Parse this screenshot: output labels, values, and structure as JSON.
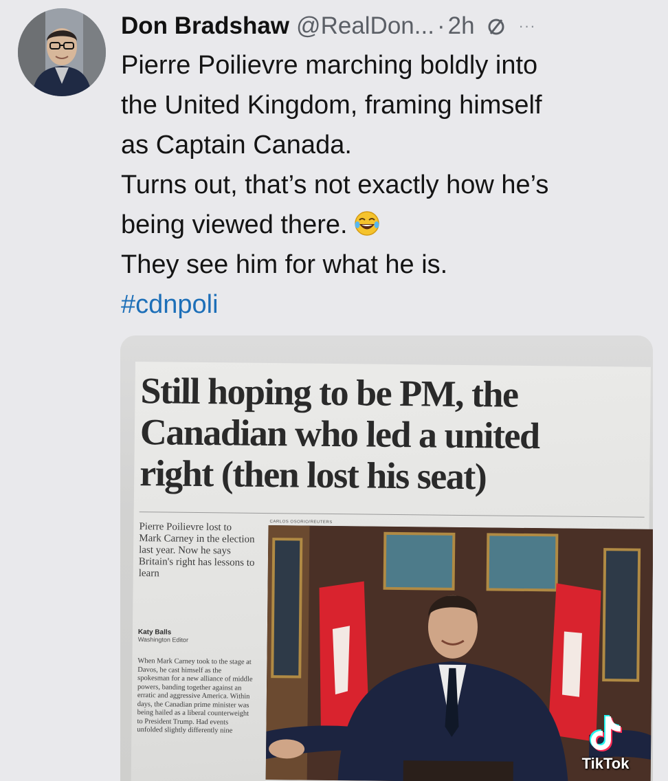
{
  "tweet": {
    "author_name": "Don Bradshaw",
    "handle": "@RealDon...",
    "separator": "·",
    "time": "2h",
    "more_label": "···",
    "lines": [
      "Pierre Poilievre marching boldly into",
      "the United Kingdom, framing himself",
      "as Captain Canada.",
      "Turns out, that’s not exactly how he’s",
      "being viewed there.",
      "They see him for what he is."
    ],
    "hashtag": "#cdnpoli"
  },
  "newspaper": {
    "headline_lines": [
      "Still hoping to be PM, the",
      "Canadian who led a united",
      "right (then lost his seat)"
    ],
    "standfirst": "Pierre Poilievre lost to Mark Carney in the election last year. Now he says Britain's right has lessons to learn",
    "byline_name": "Katy Balls",
    "byline_role": "Washington Editor",
    "article_text": "When Mark Carney took to the stage at Davos, he cast himself as the spokesman for a new alliance of middle powers, banding together against an erratic and aggressive America. Within days, the Canadian prime minister was being hailed as a liberal counterweight to President Trump. Had events unfolded slightly differently nine",
    "photo_credit": "CARLOS OSORIO/REUTERS"
  },
  "watermark": {
    "label": "TikTok"
  },
  "colors": {
    "background": "#e9e9ec",
    "hashtag": "#1d6fb8",
    "text": "#141414",
    "secondary": "#5b5f66"
  },
  "icons": [
    "avatar",
    "grok-icon",
    "more-icon",
    "laughing-emoji-icon",
    "tiktok-icon"
  ]
}
